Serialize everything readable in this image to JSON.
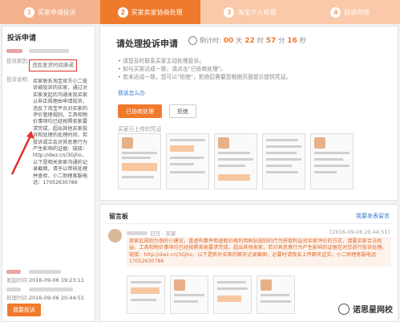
{
  "steps": [
    {
      "num": "1",
      "label": "买家申请投诉",
      "state": "done"
    },
    {
      "num": "2",
      "label": "买家卖家协商处理",
      "state": "active"
    },
    {
      "num": "3",
      "label": "淘宝介入处理",
      "state": "todo"
    },
    {
      "num": "4",
      "label": "投诉完结",
      "state": "todo"
    }
  ],
  "left": {
    "title": "投诉申请",
    "reason_key": "投诉原因",
    "reason_value": "违反发货时间承诺",
    "desc_key": "投诉说明",
    "desc_text": "买家联系淘宝官方小二投诉被投诉的买家，通过对买家发起的沟通发现买家以非正规理由申请投诉，违反了淘宝平台对买家的评价管理规则。工具和物价事项均已经按照卖家要求完成，超出其他买家投诉和处理的处理时间，若投诉成立会对其恶意行为产生影响的证据：链接：http://dwz.cn/3Gjho，以下是相关卖家沟通的记录截图，请予以审核处理并查验，小二助理客服电话：17052630786",
    "created_key": "发起时间",
    "created_time": "2016-09-06 19:23:11",
    "updated_key": "处理时间",
    "updated_time": "2016-09-06 20:44:51",
    "appeal_btn": "我要投诉"
  },
  "panel": {
    "title": "请处理投诉申请",
    "timer_label": "倒计时:",
    "timer_days": "00",
    "timer_hours": "22",
    "timer_minutes": "57",
    "timer_seconds": "16",
    "unit_day": "天",
    "unit_hour": "时",
    "unit_minute": "分",
    "unit_second": "秒",
    "note1": "• 请您及时联系买家主动处理投诉。",
    "note2": "• 如与买家达成一致，请点击\"已协商处理\"。",
    "note3": "• 若未达成一致，您可以\"拒绝\"，拒绝后需要您根据页面提示提供凭证。",
    "how_link": "我该怎么办",
    "btn_ok": "已协商处理",
    "btn_reject": "拒绝",
    "evidence_label": "买家已上传的凭证"
  },
  "messages": {
    "title": "留言板",
    "link": "我要发表留言",
    "who": "日日 - 买家",
    "time": "[2016-09-06 20:44:51]",
    "body": "卖家此规则为例的小建议，重虚构事件和虚假价格利用刷钻规则的行为获取利益对买家评价的方式，请要买家合法权益。工具和物价事项均已经按照卖家要求完成，超出其他卖家，若对其恶意行为产生影响的证据在对您进行投诉处理。链接：http://dwz.cn/3Gjho，以下是新补买家的聊天记录截图，必要时请我会上传聊天证实。小二助理客服电话17052630786"
  },
  "watermark": "诺思星网校",
  "colors": {
    "accent": "#f07a2c",
    "link": "#3a7bd5",
    "highlight": "#e0302a"
  }
}
